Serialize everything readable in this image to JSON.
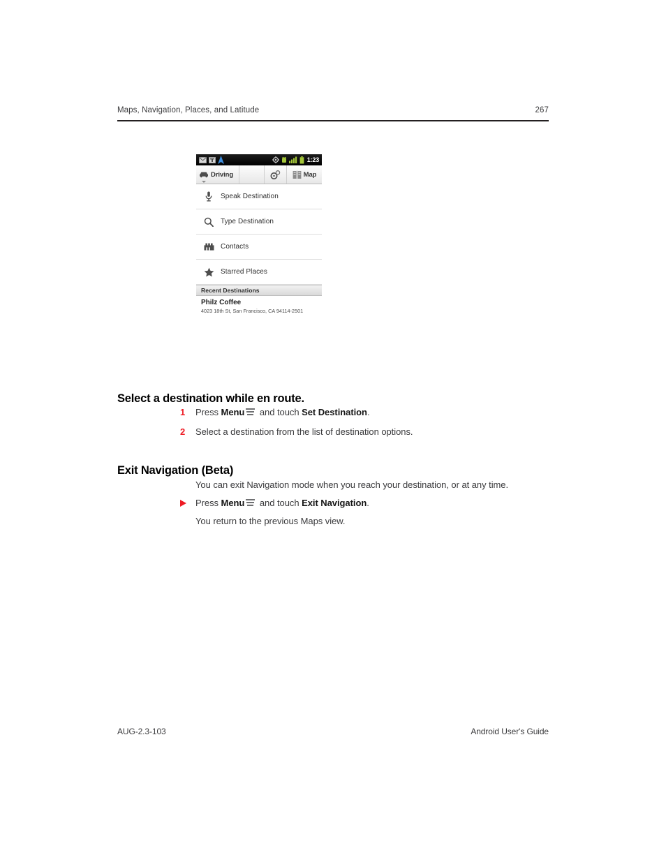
{
  "header": {
    "chapter": "Maps, Navigation, Places, and Latitude",
    "page_number": "267"
  },
  "figure": {
    "statusbar": {
      "icons_left": [
        "mail-icon",
        "sms-icon",
        "navigation-arrow-icon"
      ],
      "icons_right": [
        "gps-icon",
        "usb-debug-icon",
        "signal-bars-icon",
        "battery-icon"
      ],
      "clock": "1:23"
    },
    "actionbar": {
      "mode_label": "Driving",
      "mode_icon": "car-icon",
      "dropdown_icon": "chevron-down-icon",
      "layers_icon": "layers-icon",
      "map_label": "Map",
      "map_icon": "map-book-icon"
    },
    "rows": [
      {
        "label": "Speak Destination",
        "icon": "microphone-icon"
      },
      {
        "label": "Type Destination",
        "icon": "search-icon"
      },
      {
        "label": "Contacts",
        "icon": "contacts-icon"
      },
      {
        "label": "Starred Places",
        "icon": "star-icon"
      }
    ],
    "section_header": "Recent Destinations",
    "recent": {
      "title": "Philz Coffee",
      "address": "4023 18th St, San Francisco, CA 94114-2501"
    }
  },
  "sections": {
    "select_destination": {
      "heading": "Select a destination while en route.",
      "steps": [
        {
          "number": "1",
          "pre": "Press ",
          "bold1": "Menu",
          "mid": " and touch ",
          "bold2": "Set Destination",
          "post": "."
        },
        {
          "number": "2",
          "text": "Select a destination from the list of destination options."
        }
      ]
    },
    "exit_navigation": {
      "heading": "Exit Navigation (Beta)",
      "intro": "You can exit Navigation mode when you reach your destination, or at any time.",
      "bullet": {
        "pre": "Press ",
        "bold1": "Menu",
        "mid": " and touch ",
        "bold2": "Exit Navigation",
        "post": "."
      },
      "result": "You return to the previous Maps view."
    }
  },
  "footer": {
    "doc_code": "AUG-2.3-103",
    "doc_title": "Android User's Guide"
  },
  "colors": {
    "accent_red": "#ee1c25",
    "text": "#3a3a3c",
    "rule": "#231f20"
  }
}
